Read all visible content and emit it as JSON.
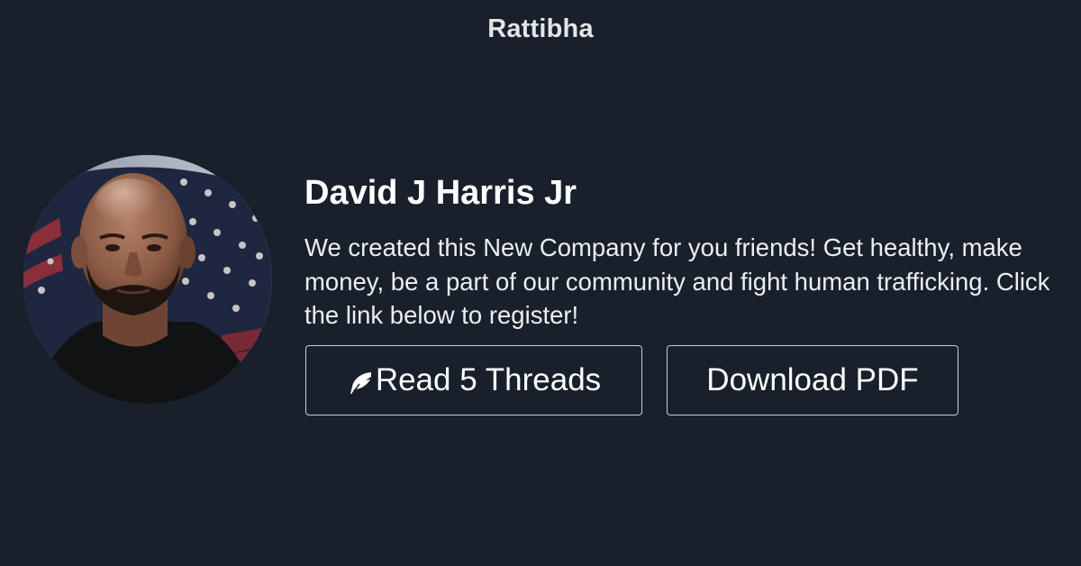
{
  "header": {
    "site_name": "Rattibha"
  },
  "profile": {
    "author_name": "David J Harris Jr",
    "description": "We created this New Company for you friends! Get healthy, make money, be a part of our community and fight human trafficking. Click the link below to register!"
  },
  "actions": {
    "read_label": "Read 5 Threads",
    "read_icon": "feather-icon",
    "pdf_label": "Download PDF"
  },
  "colors": {
    "background": "#18202b",
    "text": "#ffffff",
    "button_border": "#c9ced6"
  }
}
